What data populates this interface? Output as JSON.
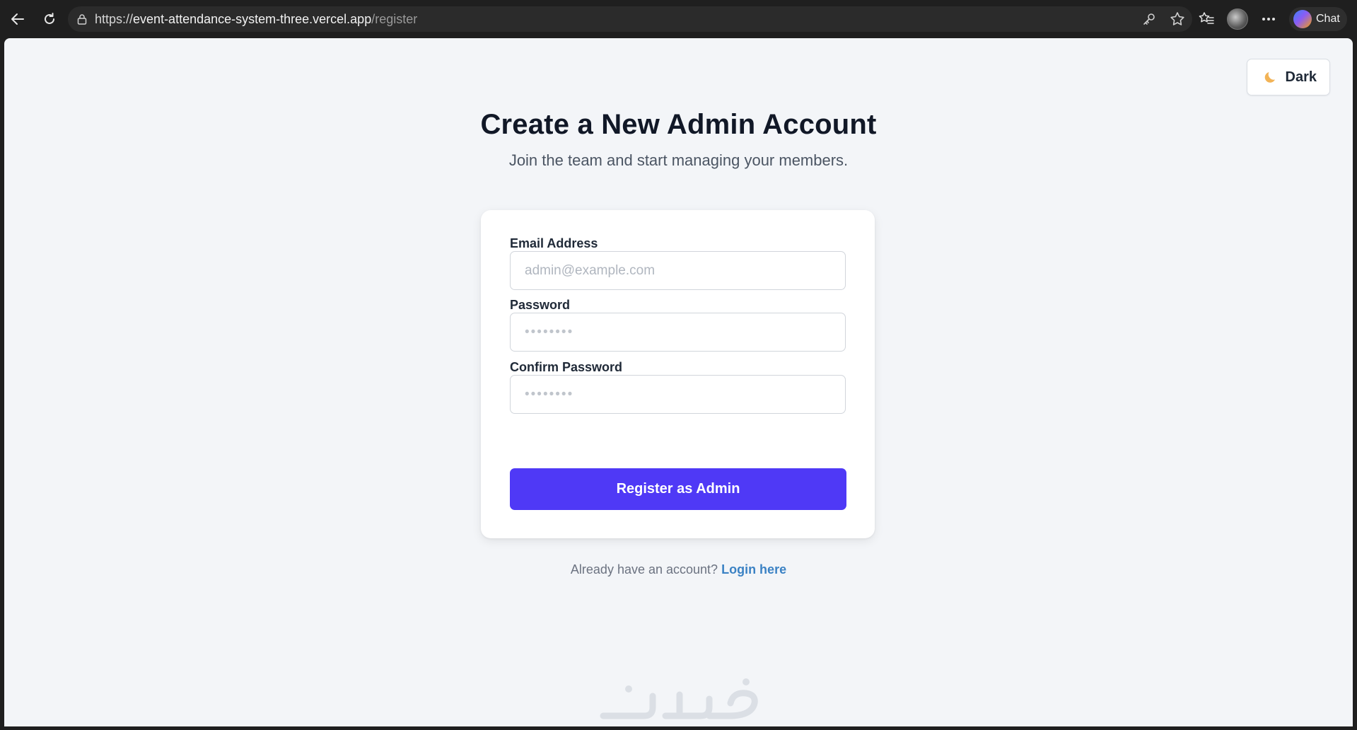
{
  "browser": {
    "url_scheme": "https://",
    "url_host": "event-attendance-system-three.vercel.app",
    "url_path": "/register",
    "chat_label": "Chat"
  },
  "theme_toggle": {
    "label": "Dark",
    "icon": "moon-icon"
  },
  "page": {
    "title": "Create a New Admin Account",
    "subtitle": "Join the team and start managing your members."
  },
  "form": {
    "email_label": "Email Address",
    "email_placeholder": "admin@example.com",
    "password_label": "Password",
    "password_placeholder": "••••••••",
    "confirm_label": "Confirm Password",
    "confirm_placeholder": "••••••••",
    "submit_label": "Register as Admin"
  },
  "footer": {
    "prompt": "Already have an account?",
    "link": "Login here"
  },
  "watermark": {
    "text": "خمسات"
  },
  "colors": {
    "primary": "#4f39f6",
    "link": "#3b82c4",
    "background": "#f3f5f8"
  }
}
